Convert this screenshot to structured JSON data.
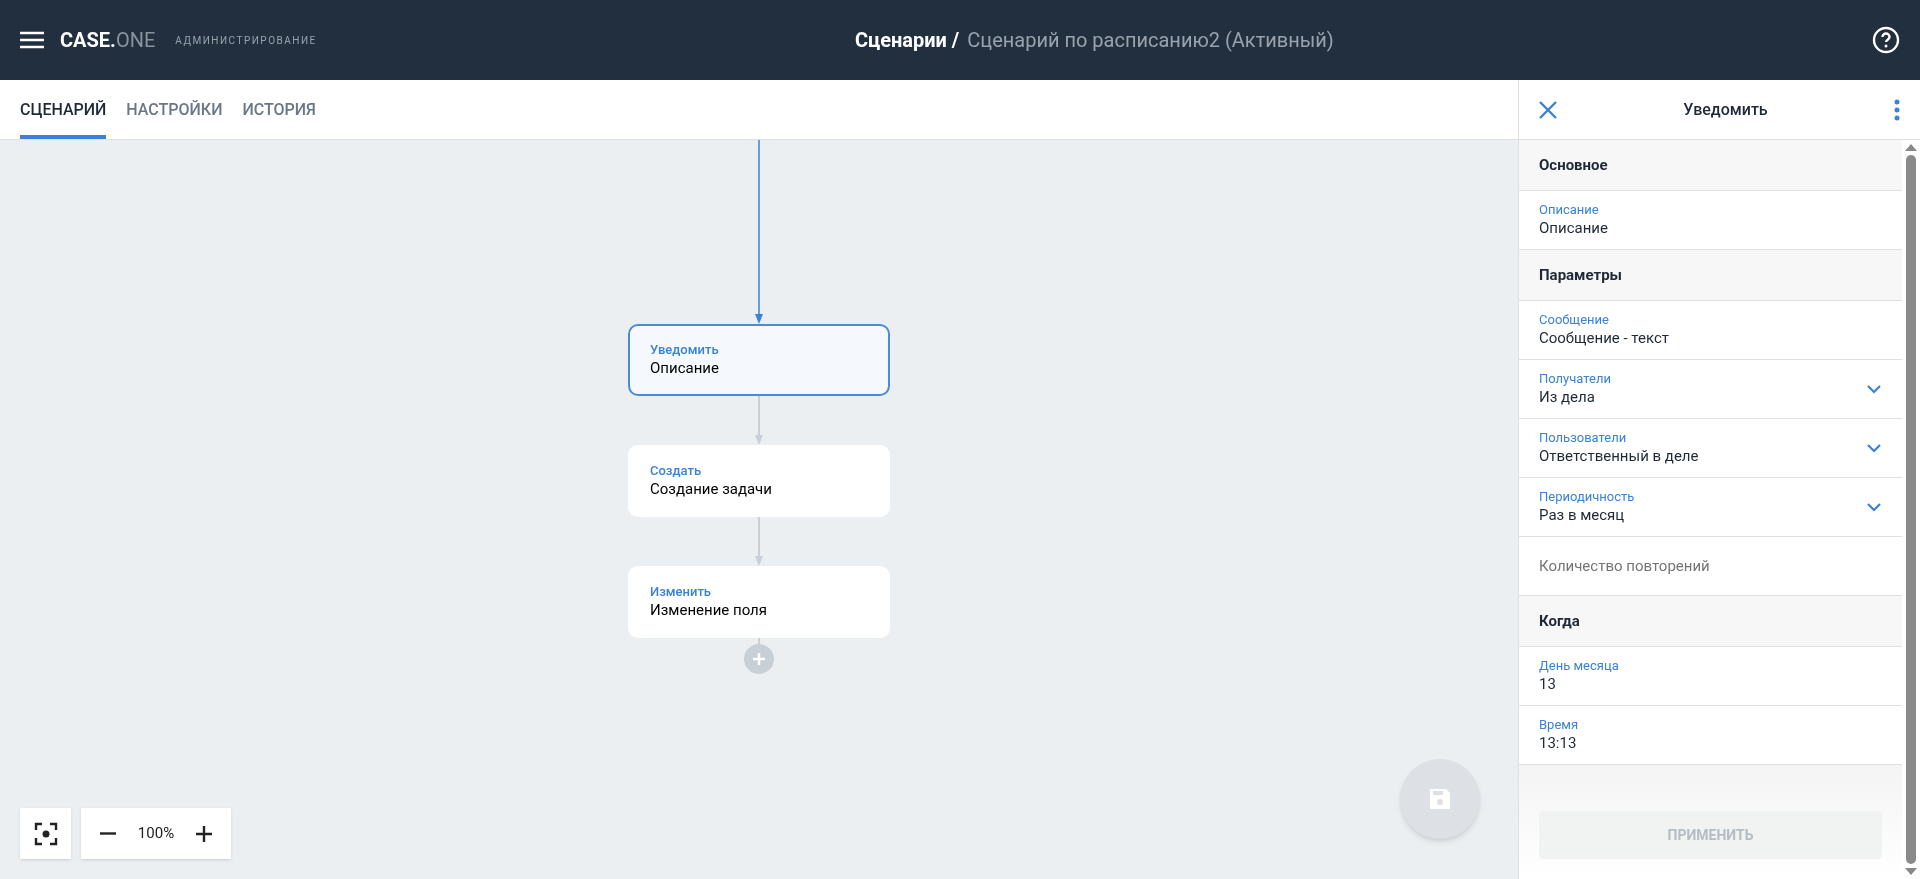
{
  "header": {
    "logo_main": "CASE.",
    "logo_sub": "ONE",
    "section": "АДМИНИСТРИРОВАНИЕ",
    "title": "Сценарии /",
    "subtitle": "Сценарий по расписанию2 (Активный)"
  },
  "tabs": [
    {
      "label": "СЦЕНАРИЙ",
      "selected": true
    },
    {
      "label": "НАСТРОЙКИ",
      "selected": false
    },
    {
      "label": "ИСТОРИЯ",
      "selected": false
    }
  ],
  "nodes": [
    {
      "type": "Уведомить",
      "label": "Описание",
      "selected": true
    },
    {
      "type": "Создать",
      "label": "Создание задачи",
      "selected": false
    },
    {
      "type": "Изменить",
      "label": "Изменение поля",
      "selected": false
    }
  ],
  "zoom": {
    "value": "100%"
  },
  "panel": {
    "title": "Уведомить",
    "rows": [
      {
        "kind": "section",
        "text": "Основное"
      },
      {
        "kind": "field",
        "label": "Описание",
        "value": "Описание"
      },
      {
        "kind": "section",
        "text": "Параметры"
      },
      {
        "kind": "field",
        "label": "Сообщение",
        "value": "Сообщение - текст"
      },
      {
        "kind": "select",
        "label": "Получатели",
        "value": "Из дела"
      },
      {
        "kind": "select",
        "label": "Пользователи",
        "value": "Ответственный в деле"
      },
      {
        "kind": "select",
        "label": "Периодичность",
        "value": "Раз в месяц"
      },
      {
        "kind": "empty",
        "placeholder": "Количество повторений"
      },
      {
        "kind": "section",
        "text": "Когда"
      },
      {
        "kind": "field",
        "label": "День месяца",
        "value": "13"
      },
      {
        "kind": "field",
        "label": "Время",
        "value": "13:13"
      }
    ],
    "apply": {
      "label": "ПРИМЕНИТЬ",
      "disabled": true
    }
  }
}
